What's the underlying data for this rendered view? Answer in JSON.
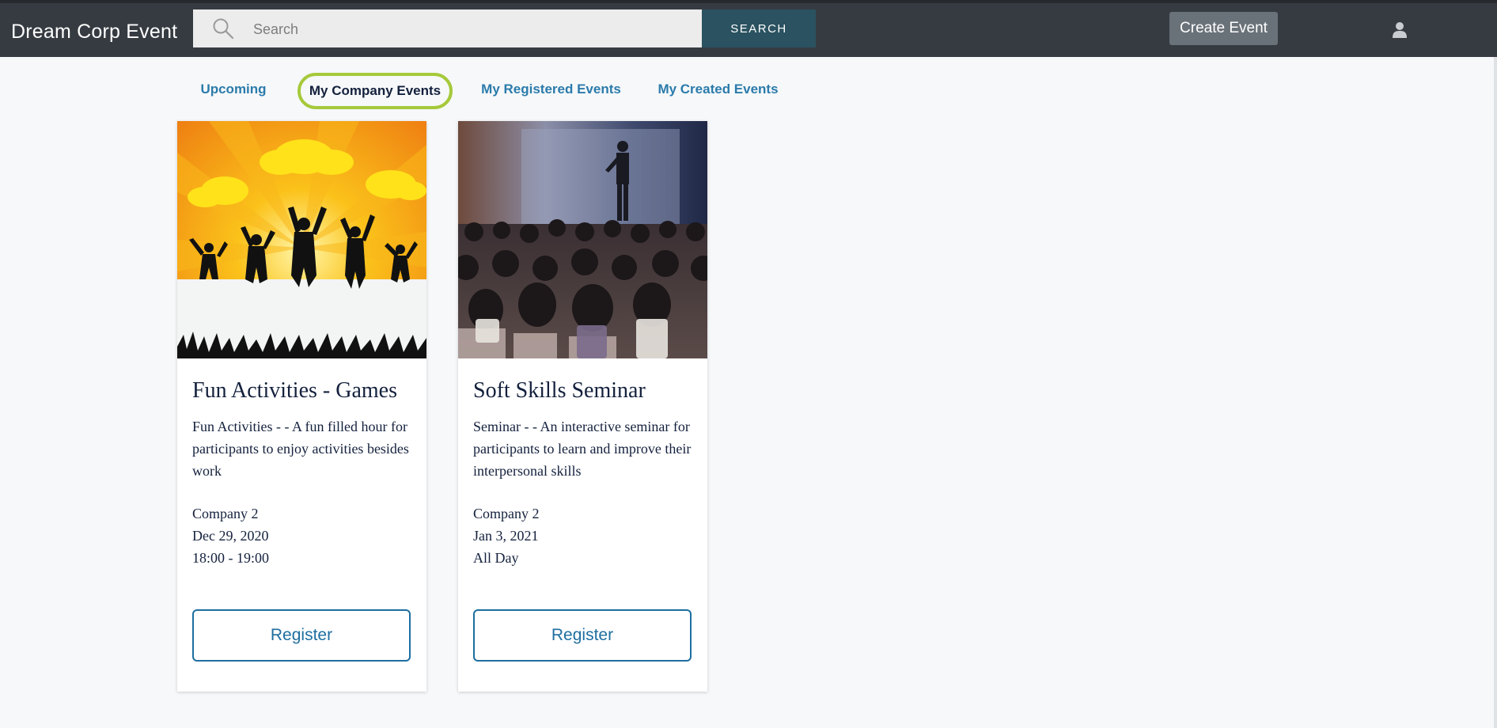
{
  "app": {
    "brand": "Dream Corp Event"
  },
  "header": {
    "search_placeholder": "Search",
    "search_button": "SEARCH",
    "create_button": "Create Event"
  },
  "tabs": [
    {
      "label": "Upcoming",
      "active": false
    },
    {
      "label": "My Company Events",
      "active": true
    },
    {
      "label": "My Registered Events",
      "active": false
    },
    {
      "label": "My Created Events",
      "active": false
    }
  ],
  "events": [
    {
      "title": "Fun Activities - Games",
      "description": "Fun Activities - - A fun filled hour for participants to enjoy activities besides work",
      "company": "Company 2",
      "date": "Dec 29, 2020",
      "time": "18:00 - 19:00",
      "button": "Register"
    },
    {
      "title": "Soft Skills Seminar",
      "description": "Seminar - - An interactive seminar for participants to learn and improve their interpersonal skills",
      "company": "Company 2",
      "date": "Jan 3, 2021",
      "time": "All Day",
      "button": "Register"
    }
  ],
  "colors": {
    "topbar": "#363b42",
    "search_button": "#2a5260",
    "active_tab_border": "#a6c93a",
    "tab_text": "#2b7bab",
    "register_accent": "#1e6ea0"
  }
}
